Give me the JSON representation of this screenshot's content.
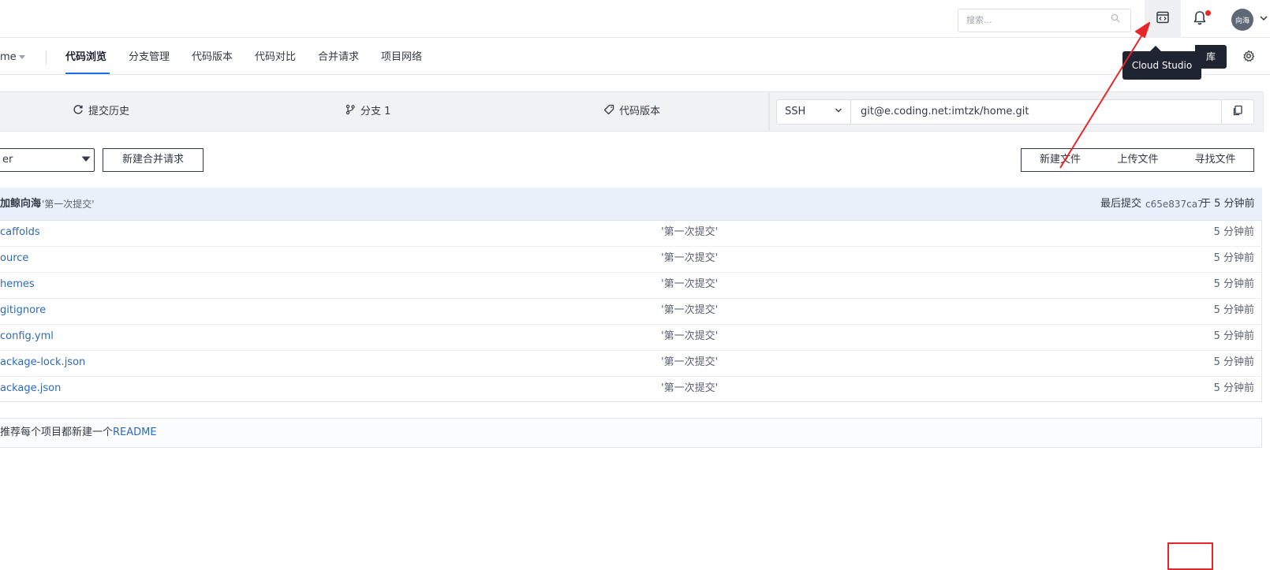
{
  "topbar": {
    "search_placeholder": "搜索...",
    "avatar_text": "向海"
  },
  "nav": {
    "repo_name": "me",
    "tabs": [
      {
        "label": "代码浏览",
        "active": true
      },
      {
        "label": "分支管理"
      },
      {
        "label": "代码版本"
      },
      {
        "label": "代码对比"
      },
      {
        "label": "合并请求"
      },
      {
        "label": "项目网络"
      }
    ],
    "tooltip": "Cloud Studio",
    "hidden_button": "库"
  },
  "stats": {
    "history": "提交历史",
    "branches": "分支 1",
    "tags": "代码版本"
  },
  "clone": {
    "protocol": "SSH",
    "url": "git@e.coding.net:imtzk/home.git"
  },
  "toolbar": {
    "branch": "er",
    "merge_request": "新建合并请求",
    "new_file": "新建文件",
    "upload_file": "上传文件",
    "find_file": "寻找文件"
  },
  "last_commit": {
    "author": "加鲸向海",
    "message": "'第一次提交'",
    "label": "最后提交",
    "hash": "c65e837ca7",
    "time": "于 5 分钟前"
  },
  "files": [
    {
      "name": "caffolds",
      "message": "'第一次提交'",
      "time": "5 分钟前"
    },
    {
      "name": "ource",
      "message": "'第一次提交'",
      "time": "5 分钟前"
    },
    {
      "name": "hemes",
      "message": "'第一次提交'",
      "time": "5 分钟前"
    },
    {
      "name": "gitignore",
      "message": "'第一次提交'",
      "time": "5 分钟前"
    },
    {
      "name": "config.yml",
      "message": "'第一次提交'",
      "time": "5 分钟前"
    },
    {
      "name": "ackage-lock.json",
      "message": "'第一次提交'",
      "time": "5 分钟前"
    },
    {
      "name": "ackage.json",
      "message": "'第一次提交'",
      "time": "5 分钟前"
    }
  ],
  "readme": {
    "text": "推荐每个项目都新建一个",
    "link": "README"
  },
  "colors": {
    "accent": "#1a6ee6",
    "link": "#2d6bb5",
    "annotation": "#e8262a",
    "tooltip_bg": "#1f2433"
  }
}
